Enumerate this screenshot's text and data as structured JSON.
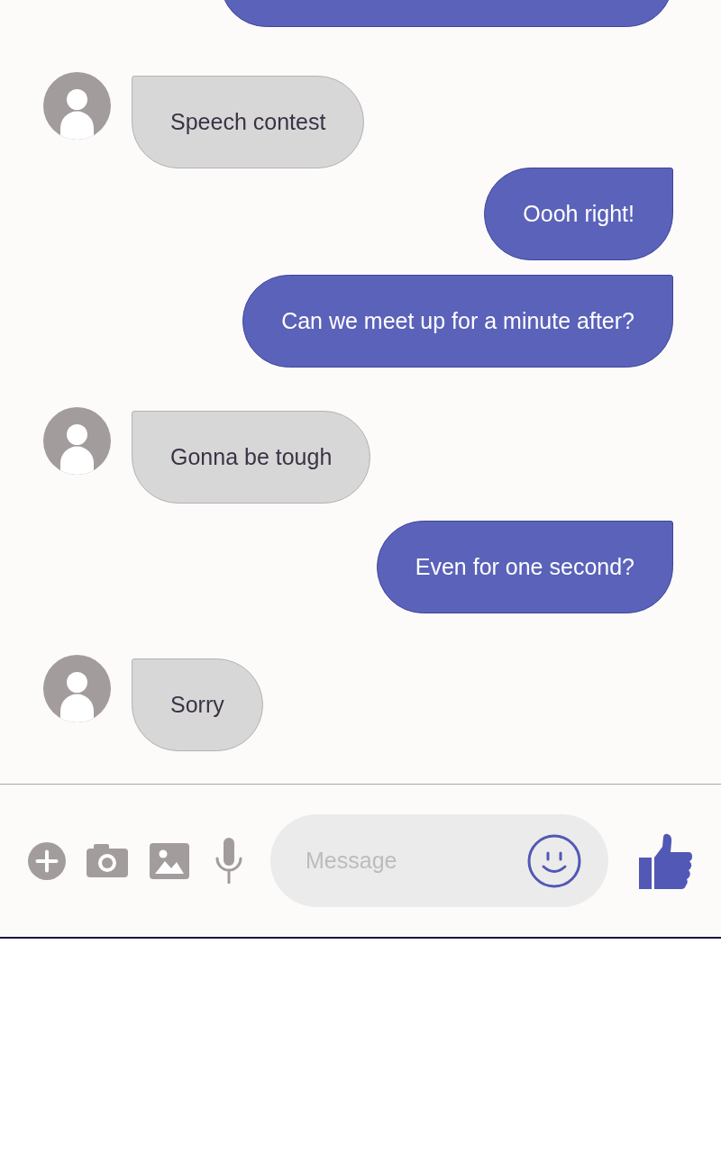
{
  "conversation": {
    "messages": [
      {
        "kind": "sent"
      },
      {
        "kind": "received",
        "text": "Speech contest"
      },
      {
        "kind": "sent",
        "text": "Oooh right!"
      },
      {
        "kind": "sent",
        "text": "Can we meet up for a minute after?"
      },
      {
        "kind": "received",
        "text": "Gonna be tough"
      },
      {
        "kind": "sent",
        "text": "Even for one second?"
      },
      {
        "kind": "received",
        "text": "Sorry"
      }
    ]
  },
  "composer": {
    "placeholder": "Message"
  }
}
